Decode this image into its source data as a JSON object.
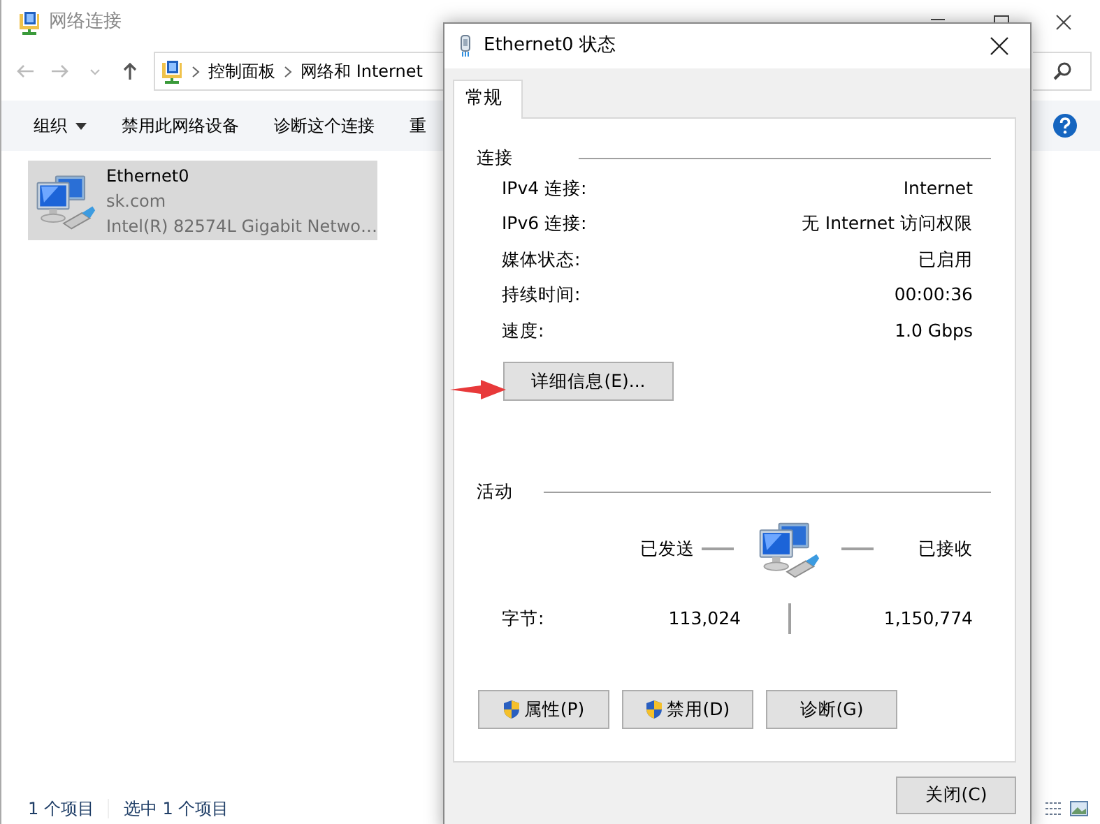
{
  "explorer": {
    "title": "网络连接",
    "breadcrumb": [
      "控制面板",
      "网络和 Internet"
    ],
    "toolbar": [
      {
        "label": "组织",
        "dropdown": true
      },
      {
        "label": "禁用此网络设备",
        "dropdown": false
      },
      {
        "label": "诊断这个连接",
        "dropdown": false
      },
      {
        "label": "重",
        "dropdown": false
      }
    ],
    "items": [
      {
        "name": "Ethernet0",
        "domain": "sk.com",
        "adapter": "Intel(R) 82574L Gigabit Netwo…",
        "selected": true
      }
    ],
    "status_bar": [
      "1 个项目",
      "选中 1 个项目"
    ]
  },
  "dialog": {
    "title": "Ethernet0 状态",
    "tabs": [
      {
        "label": "常规",
        "selected": true
      }
    ],
    "connection": {
      "heading": "连接",
      "rows": [
        {
          "label": "IPv4 连接:",
          "value": "Internet"
        },
        {
          "label": "IPv6 连接:",
          "value": "无 Internet 访问权限"
        },
        {
          "label": "媒体状态:",
          "value": "已启用"
        },
        {
          "label": "持续时间:",
          "value": "00:00:36"
        },
        {
          "label": "速度:",
          "value": "1.0 Gbps"
        }
      ],
      "details_button": "详细信息(E)..."
    },
    "activity": {
      "heading": "活动",
      "sent_label": "已发送",
      "received_label": "已接收",
      "bytes_label": "字节:",
      "bytes_sent": "113,024",
      "bytes_received": "1,150,774"
    },
    "buttons": [
      {
        "label": "属性(P)",
        "shield": true
      },
      {
        "label": "禁用(D)",
        "shield": true
      },
      {
        "label": "诊断(G)",
        "shield": false
      }
    ],
    "close_button": "关闭(C)"
  }
}
